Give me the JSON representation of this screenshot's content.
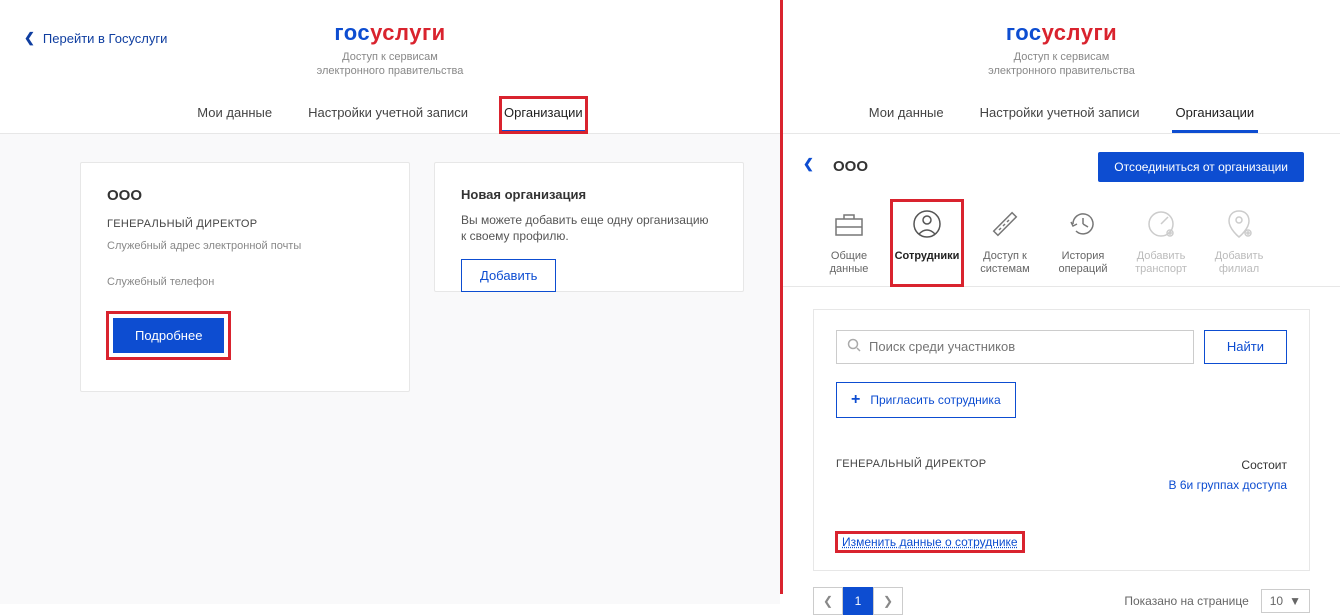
{
  "brand": {
    "logo1": "гос",
    "logo2": "услуги",
    "sub1": "Доступ к сервисам",
    "sub2": "электронного правительства"
  },
  "back": "Перейти в Госуслуги",
  "tabs": {
    "my": "Мои данные",
    "settings": "Настройки учетной записи",
    "org": "Организации"
  },
  "left": {
    "org_name": "ООО",
    "role": "ГЕНЕРАЛЬНЫЙ ДИРЕКТОР",
    "email_lbl": "Служебный адрес электронной почты",
    "phone_lbl": "Служебный телефон",
    "more_btn": "Подробнее",
    "new_title": "Новая организация",
    "new_desc": "Вы можете добавить еще одну организацию к своему профилю.",
    "add_btn": "Добавить"
  },
  "right": {
    "org_name": "ООО",
    "disconnect": "Отсоединиться от организации",
    "tabs": {
      "general": "Общие данные",
      "employees": "Сотрудники",
      "access": "Доступ к системам",
      "history": "История операций",
      "transport": "Добавить транспорт",
      "branch": "Добавить филиал"
    },
    "search_ph": "Поиск среди участников",
    "find": "Найти",
    "invite": "Пригласить сотрудника",
    "emp_role": "ГЕНЕРАЛЬНЫЙ ДИРЕКТОР",
    "member_h": "Состоит",
    "member_v": "В 6и группах доступа",
    "edit": "Изменить данные о сотруднике",
    "pager_text": "Показано на странице",
    "pager_sel": "10",
    "page": "1"
  }
}
